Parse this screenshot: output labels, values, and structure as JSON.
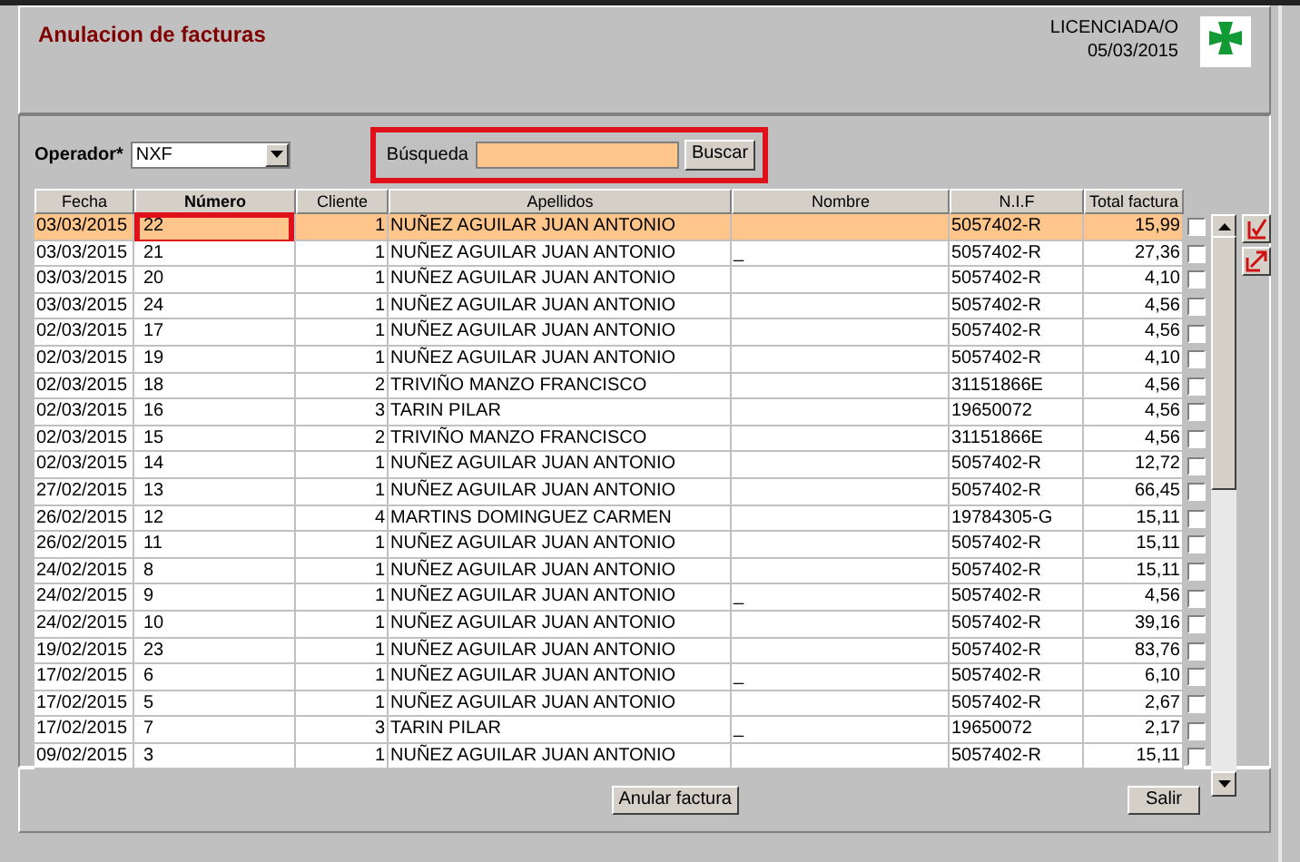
{
  "window": {
    "title": "Anulacion de facturas",
    "user": "LICENCIADA/O",
    "date": "05/03/2015"
  },
  "filters": {
    "operator_label": "Operador*",
    "operator_value": "NXF",
    "search_label": "Búsqueda",
    "search_button": "Buscar"
  },
  "table": {
    "columns": [
      "Fecha",
      "Número",
      "Cliente",
      "Apellidos",
      "Nombre",
      "N.I.F",
      "Total factura"
    ],
    "rows": [
      {
        "fecha": "03/03/2015",
        "numero": "22",
        "cliente": "1",
        "apellidos": "NUÑEZ AGUILAR JUAN ANTONIO",
        "nombre": "",
        "nif": "5057402-R",
        "total": "15,99",
        "selected": true,
        "checked": false,
        "annotated": true
      },
      {
        "fecha": "03/03/2015",
        "numero": "21",
        "cliente": "1",
        "apellidos": "NUÑEZ AGUILAR JUAN ANTONIO",
        "nombre": "_",
        "nif": "5057402-R",
        "total": "27,36",
        "selected": false,
        "checked": false
      },
      {
        "fecha": "03/03/2015",
        "numero": "20",
        "cliente": "1",
        "apellidos": "NUÑEZ AGUILAR JUAN ANTONIO",
        "nombre": "",
        "nif": "5057402-R",
        "total": "4,10",
        "selected": false,
        "checked": false
      },
      {
        "fecha": "03/03/2015",
        "numero": "24",
        "cliente": "1",
        "apellidos": "NUÑEZ AGUILAR JUAN ANTONIO",
        "nombre": "",
        "nif": "5057402-R",
        "total": "4,56",
        "selected": false,
        "checked": false
      },
      {
        "fecha": "02/03/2015",
        "numero": "17",
        "cliente": "1",
        "apellidos": "NUÑEZ AGUILAR JUAN ANTONIO",
        "nombre": "",
        "nif": "5057402-R",
        "total": "4,56",
        "selected": false,
        "checked": false
      },
      {
        "fecha": "02/03/2015",
        "numero": "19",
        "cliente": "1",
        "apellidos": "NUÑEZ AGUILAR JUAN ANTONIO",
        "nombre": "",
        "nif": "5057402-R",
        "total": "4,10",
        "selected": false,
        "checked": false
      },
      {
        "fecha": "02/03/2015",
        "numero": "18",
        "cliente": "2",
        "apellidos": "TRIVIÑO MANZO FRANCISCO",
        "nombre": "",
        "nif": "31151866E",
        "total": "4,56",
        "selected": false,
        "checked": false
      },
      {
        "fecha": "02/03/2015",
        "numero": "16",
        "cliente": "3",
        "apellidos": "TARIN PILAR",
        "nombre": "",
        "nif": "19650072",
        "total": "4,56",
        "selected": false,
        "checked": false
      },
      {
        "fecha": "02/03/2015",
        "numero": "15",
        "cliente": "2",
        "apellidos": "TRIVIÑO MANZO FRANCISCO",
        "nombre": "",
        "nif": "31151866E",
        "total": "4,56",
        "selected": false,
        "checked": false
      },
      {
        "fecha": "02/03/2015",
        "numero": "14",
        "cliente": "1",
        "apellidos": "NUÑEZ AGUILAR JUAN ANTONIO",
        "nombre": "",
        "nif": "5057402-R",
        "total": "12,72",
        "selected": false,
        "checked": false
      },
      {
        "fecha": "27/02/2015",
        "numero": "13",
        "cliente": "1",
        "apellidos": "NUÑEZ AGUILAR JUAN ANTONIO",
        "nombre": "",
        "nif": "5057402-R",
        "total": "66,45",
        "selected": false,
        "checked": false
      },
      {
        "fecha": "26/02/2015",
        "numero": "12",
        "cliente": "4",
        "apellidos": "MARTINS DOMINGUEZ CARMEN",
        "nombre": "",
        "nif": "19784305-G",
        "total": "15,11",
        "selected": false,
        "checked": false
      },
      {
        "fecha": "26/02/2015",
        "numero": "11",
        "cliente": "1",
        "apellidos": "NUÑEZ AGUILAR JUAN ANTONIO",
        "nombre": "",
        "nif": "5057402-R",
        "total": "15,11",
        "selected": false,
        "checked": false
      },
      {
        "fecha": "24/02/2015",
        "numero": "8",
        "cliente": "1",
        "apellidos": "NUÑEZ AGUILAR JUAN ANTONIO",
        "nombre": "",
        "nif": "5057402-R",
        "total": "15,11",
        "selected": false,
        "checked": false
      },
      {
        "fecha": "24/02/2015",
        "numero": "9",
        "cliente": "1",
        "apellidos": "NUÑEZ AGUILAR JUAN ANTONIO",
        "nombre": "_",
        "nif": "5057402-R",
        "total": "4,56",
        "selected": false,
        "checked": false
      },
      {
        "fecha": "24/02/2015",
        "numero": "10",
        "cliente": "1",
        "apellidos": "NUÑEZ AGUILAR JUAN ANTONIO",
        "nombre": "",
        "nif": "5057402-R",
        "total": "39,16",
        "selected": false,
        "checked": false
      },
      {
        "fecha": "19/02/2015",
        "numero": "23",
        "cliente": "1",
        "apellidos": "NUÑEZ AGUILAR JUAN ANTONIO",
        "nombre": "",
        "nif": "5057402-R",
        "total": "83,76",
        "selected": false,
        "checked": false
      },
      {
        "fecha": "17/02/2015",
        "numero": "6",
        "cliente": "1",
        "apellidos": "NUÑEZ AGUILAR JUAN ANTONIO",
        "nombre": "_",
        "nif": "5057402-R",
        "total": "6,10",
        "selected": false,
        "checked": false
      },
      {
        "fecha": "17/02/2015",
        "numero": "5",
        "cliente": "1",
        "apellidos": "NUÑEZ AGUILAR JUAN ANTONIO",
        "nombre": "",
        "nif": "5057402-R",
        "total": "2,67",
        "selected": false,
        "checked": false
      },
      {
        "fecha": "17/02/2015",
        "numero": "7",
        "cliente": "3",
        "apellidos": "TARIN PILAR",
        "nombre": "_",
        "nif": "19650072",
        "total": "2,17",
        "selected": false,
        "checked": false
      },
      {
        "fecha": "09/02/2015",
        "numero": "3",
        "cliente": "1",
        "apellidos": "NUÑEZ AGUILAR JUAN ANTONIO",
        "nombre": "",
        "nif": "5057402-R",
        "total": "15,11",
        "selected": false,
        "checked": false
      }
    ]
  },
  "buttons": {
    "cancel": "Anular factura",
    "exit": "Salir"
  }
}
